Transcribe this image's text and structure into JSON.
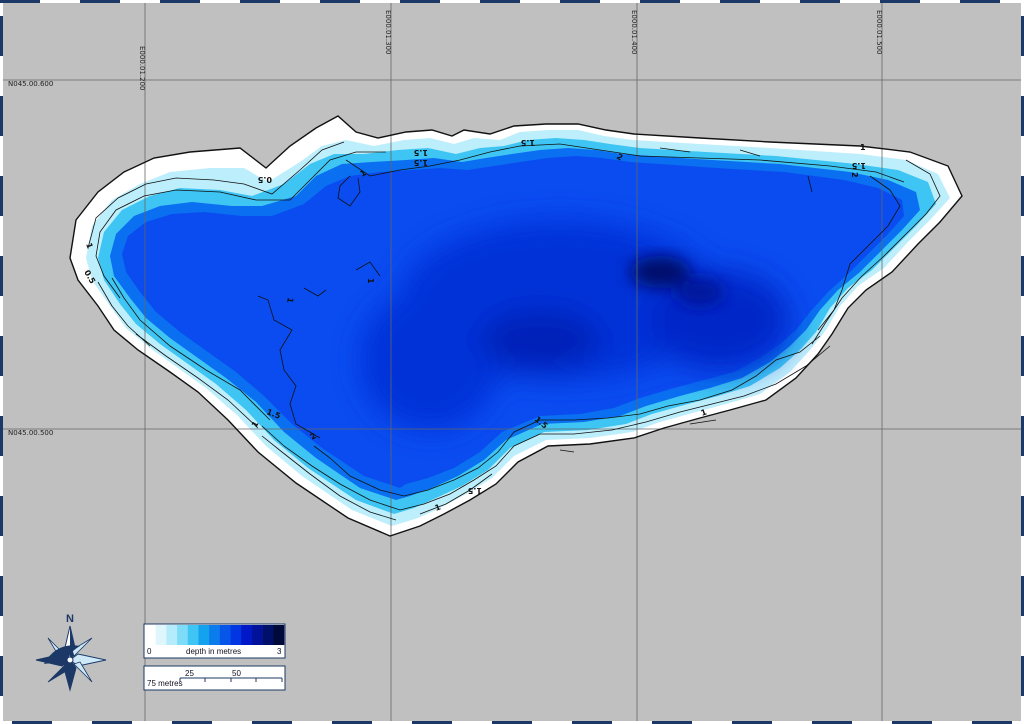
{
  "grid": {
    "longitude_labels": [
      "E000.01.200",
      "E000.01.300",
      "E000.01.400",
      "E000.01.500"
    ],
    "latitude_labels": [
      "N045.00.600",
      "N045.00.500"
    ]
  },
  "contours": {
    "labels": [
      "0.5",
      "1",
      "1.5",
      "1",
      "1.5",
      "2",
      "1",
      "1.5",
      "1",
      "1.5",
      "1",
      "0.5",
      "1",
      "1.5",
      "2",
      "1.5",
      "1",
      "1",
      "1.5",
      "2"
    ]
  },
  "depth_legend": {
    "title": "depth in metres",
    "min_label": "0",
    "max_label": "3",
    "range": [
      0,
      3
    ],
    "colors": [
      "#ffffff",
      "#dff6fd",
      "#b5ecfb",
      "#7edcf8",
      "#3ec5f3",
      "#12a2ee",
      "#0a7cec",
      "#0656ea",
      "#0236e3",
      "#0018c8",
      "#00129a",
      "#000f6a",
      "#000a3a"
    ]
  },
  "scale_bar": {
    "label": "75 metres",
    "ticks": [
      "25",
      "50"
    ]
  },
  "compass": {
    "north_label": "N",
    "icon": "compass-rose-icon"
  },
  "colors": {
    "background": "#c0c0c0",
    "frame": "#1c3866",
    "shallow": "#ffffff",
    "deep": "#000a3a"
  }
}
